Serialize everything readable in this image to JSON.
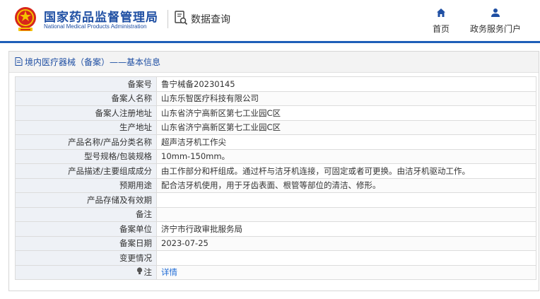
{
  "header": {
    "org_name_cn": "国家药品监督管理局",
    "org_name_en": "National Medical Products Administration",
    "query_label": "数据查询",
    "nav": [
      {
        "label": "首页",
        "icon": "home-icon"
      },
      {
        "label": "政务服务门户",
        "icon": "user-icon"
      }
    ],
    "brand_color": "#1f4fa3",
    "emblem_colors": {
      "red": "#d7261b",
      "gold": "#f5c200"
    }
  },
  "panel": {
    "title": "境内医疗器械（备案）——基本信息",
    "title_icon": "document-icon",
    "rows": [
      {
        "key": "备案号",
        "value": "鲁宁械备20230145"
      },
      {
        "key": "备案人名称",
        "value": "山东乐智医疗科技有限公司"
      },
      {
        "key": "备案人注册地址",
        "value": "山东省济宁高新区第七工业园C区"
      },
      {
        "key": "生产地址",
        "value": "山东省济宁高新区第七工业园C区"
      },
      {
        "key": "产品名称/产品分类名称",
        "value": "超声洁牙机工作尖"
      },
      {
        "key": "型号规格/包装规格",
        "value": "10mm-150mm。"
      },
      {
        "key": "产品描述/主要组成成分",
        "value": "由工作部分和杆组成。通过杆与洁牙机连接，可固定或者可更换。由洁牙机驱动工作。"
      },
      {
        "key": "预期用途",
        "value": "配合洁牙机使用，用于牙齿表面、根管等部位的清洁、修形。"
      },
      {
        "key": "产品存储及有效期",
        "value": ""
      },
      {
        "key": "备注",
        "value": ""
      },
      {
        "key": "备案单位",
        "value": "济宁市行政审批服务局"
      },
      {
        "key": "备案日期",
        "value": "2023-07-25"
      },
      {
        "key": "变更情况",
        "value": ""
      }
    ],
    "note": {
      "key": "注",
      "icon": "info-bulb-icon",
      "link": "详情"
    }
  }
}
